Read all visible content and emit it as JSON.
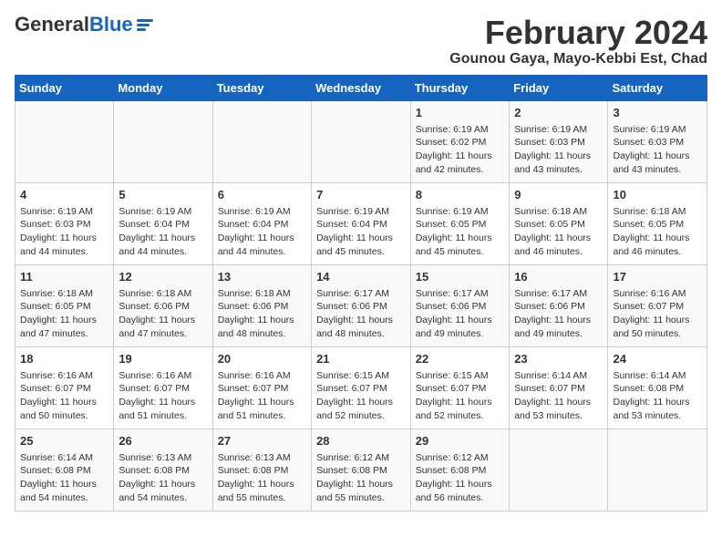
{
  "header": {
    "logo_general": "General",
    "logo_blue": "Blue",
    "main_title": "February 2024",
    "subtitle": "Gounou Gaya, Mayo-Kebbi Est, Chad"
  },
  "calendar": {
    "days_of_week": [
      "Sunday",
      "Monday",
      "Tuesday",
      "Wednesday",
      "Thursday",
      "Friday",
      "Saturday"
    ],
    "weeks": [
      [
        {
          "day": "",
          "info": ""
        },
        {
          "day": "",
          "info": ""
        },
        {
          "day": "",
          "info": ""
        },
        {
          "day": "",
          "info": ""
        },
        {
          "day": "1",
          "info": "Sunrise: 6:19 AM\nSunset: 6:02 PM\nDaylight: 11 hours\nand 42 minutes."
        },
        {
          "day": "2",
          "info": "Sunrise: 6:19 AM\nSunset: 6:03 PM\nDaylight: 11 hours\nand 43 minutes."
        },
        {
          "day": "3",
          "info": "Sunrise: 6:19 AM\nSunset: 6:03 PM\nDaylight: 11 hours\nand 43 minutes."
        }
      ],
      [
        {
          "day": "4",
          "info": "Sunrise: 6:19 AM\nSunset: 6:03 PM\nDaylight: 11 hours\nand 44 minutes."
        },
        {
          "day": "5",
          "info": "Sunrise: 6:19 AM\nSunset: 6:04 PM\nDaylight: 11 hours\nand 44 minutes."
        },
        {
          "day": "6",
          "info": "Sunrise: 6:19 AM\nSunset: 6:04 PM\nDaylight: 11 hours\nand 44 minutes."
        },
        {
          "day": "7",
          "info": "Sunrise: 6:19 AM\nSunset: 6:04 PM\nDaylight: 11 hours\nand 45 minutes."
        },
        {
          "day": "8",
          "info": "Sunrise: 6:19 AM\nSunset: 6:05 PM\nDaylight: 11 hours\nand 45 minutes."
        },
        {
          "day": "9",
          "info": "Sunrise: 6:18 AM\nSunset: 6:05 PM\nDaylight: 11 hours\nand 46 minutes."
        },
        {
          "day": "10",
          "info": "Sunrise: 6:18 AM\nSunset: 6:05 PM\nDaylight: 11 hours\nand 46 minutes."
        }
      ],
      [
        {
          "day": "11",
          "info": "Sunrise: 6:18 AM\nSunset: 6:05 PM\nDaylight: 11 hours\nand 47 minutes."
        },
        {
          "day": "12",
          "info": "Sunrise: 6:18 AM\nSunset: 6:06 PM\nDaylight: 11 hours\nand 47 minutes."
        },
        {
          "day": "13",
          "info": "Sunrise: 6:18 AM\nSunset: 6:06 PM\nDaylight: 11 hours\nand 48 minutes."
        },
        {
          "day": "14",
          "info": "Sunrise: 6:17 AM\nSunset: 6:06 PM\nDaylight: 11 hours\nand 48 minutes."
        },
        {
          "day": "15",
          "info": "Sunrise: 6:17 AM\nSunset: 6:06 PM\nDaylight: 11 hours\nand 49 minutes."
        },
        {
          "day": "16",
          "info": "Sunrise: 6:17 AM\nSunset: 6:06 PM\nDaylight: 11 hours\nand 49 minutes."
        },
        {
          "day": "17",
          "info": "Sunrise: 6:16 AM\nSunset: 6:07 PM\nDaylight: 11 hours\nand 50 minutes."
        }
      ],
      [
        {
          "day": "18",
          "info": "Sunrise: 6:16 AM\nSunset: 6:07 PM\nDaylight: 11 hours\nand 50 minutes."
        },
        {
          "day": "19",
          "info": "Sunrise: 6:16 AM\nSunset: 6:07 PM\nDaylight: 11 hours\nand 51 minutes."
        },
        {
          "day": "20",
          "info": "Sunrise: 6:16 AM\nSunset: 6:07 PM\nDaylight: 11 hours\nand 51 minutes."
        },
        {
          "day": "21",
          "info": "Sunrise: 6:15 AM\nSunset: 6:07 PM\nDaylight: 11 hours\nand 52 minutes."
        },
        {
          "day": "22",
          "info": "Sunrise: 6:15 AM\nSunset: 6:07 PM\nDaylight: 11 hours\nand 52 minutes."
        },
        {
          "day": "23",
          "info": "Sunrise: 6:14 AM\nSunset: 6:07 PM\nDaylight: 11 hours\nand 53 minutes."
        },
        {
          "day": "24",
          "info": "Sunrise: 6:14 AM\nSunset: 6:08 PM\nDaylight: 11 hours\nand 53 minutes."
        }
      ],
      [
        {
          "day": "25",
          "info": "Sunrise: 6:14 AM\nSunset: 6:08 PM\nDaylight: 11 hours\nand 54 minutes."
        },
        {
          "day": "26",
          "info": "Sunrise: 6:13 AM\nSunset: 6:08 PM\nDaylight: 11 hours\nand 54 minutes."
        },
        {
          "day": "27",
          "info": "Sunrise: 6:13 AM\nSunset: 6:08 PM\nDaylight: 11 hours\nand 55 minutes."
        },
        {
          "day": "28",
          "info": "Sunrise: 6:12 AM\nSunset: 6:08 PM\nDaylight: 11 hours\nand 55 minutes."
        },
        {
          "day": "29",
          "info": "Sunrise: 6:12 AM\nSunset: 6:08 PM\nDaylight: 11 hours\nand 56 minutes."
        },
        {
          "day": "",
          "info": ""
        },
        {
          "day": "",
          "info": ""
        }
      ]
    ]
  }
}
